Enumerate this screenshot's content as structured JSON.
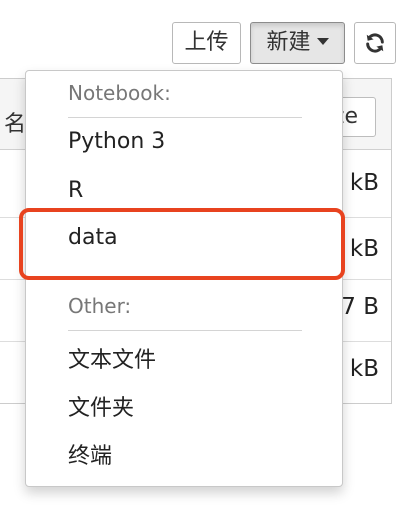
{
  "toolbar": {
    "upload_label": "上传",
    "new_label": "新建"
  },
  "table": {
    "header_name_fragment": "名",
    "header_size_fragment": "ze",
    "rows": [
      {
        "size": "kB"
      },
      {
        "size": "kB"
      },
      {
        "size": "7 B"
      },
      {
        "size": "kB"
      }
    ]
  },
  "dropdown": {
    "notebook_header": "Notebook:",
    "notebook_items": [
      "Python 3",
      "R",
      "data"
    ],
    "other_header": "Other:",
    "other_items": [
      "文本文件",
      "文件夹",
      "终端"
    ]
  },
  "colors": {
    "highlight": "#e8431f"
  }
}
